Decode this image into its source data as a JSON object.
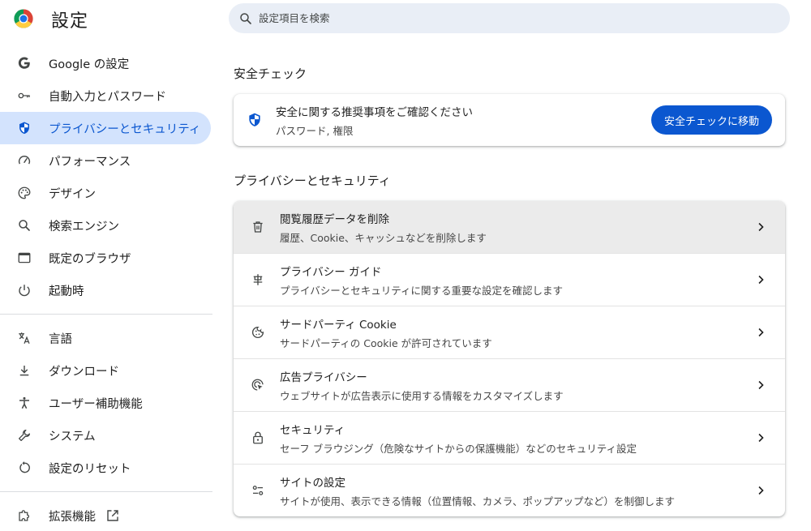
{
  "app": {
    "title": "設定"
  },
  "search": {
    "placeholder": "設定項目を検索"
  },
  "sidebar": {
    "items": [
      {
        "label": "Google の設定",
        "icon": "google-icon"
      },
      {
        "label": "自動入力とパスワード",
        "icon": "key-icon"
      },
      {
        "label": "プライバシーとセキュリティ",
        "icon": "shield-icon",
        "active": true
      },
      {
        "label": "パフォーマンス",
        "icon": "speedometer-icon"
      },
      {
        "label": "デザイン",
        "icon": "palette-icon"
      },
      {
        "label": "検索エンジン",
        "icon": "search-icon"
      },
      {
        "label": "既定のブラウザ",
        "icon": "browser-window-icon"
      },
      {
        "label": "起動時",
        "icon": "power-icon"
      },
      {
        "label": "言語",
        "icon": "translate-icon"
      },
      {
        "label": "ダウンロード",
        "icon": "download-icon"
      },
      {
        "label": "ユーザー補助機能",
        "icon": "accessibility-icon"
      },
      {
        "label": "システム",
        "icon": "wrench-icon"
      },
      {
        "label": "設定のリセット",
        "icon": "reset-icon"
      },
      {
        "label": "拡張機能",
        "icon": "puzzle-icon"
      }
    ]
  },
  "safety_check": {
    "title": "安全チェック",
    "primary": "安全に関する推奨事項をご確認ください",
    "secondary": "パスワード, 権限",
    "button": "安全チェックに移動"
  },
  "privacy": {
    "title": "プライバシーとセキュリティ",
    "rows": [
      {
        "primary": "閲覧履歴データを削除",
        "secondary": "履歴、Cookie、キャッシュなどを削除します",
        "icon": "trash-icon"
      },
      {
        "primary": "プライバシー ガイド",
        "secondary": "プライバシーとセキュリティに関する重要な設定を確認します",
        "icon": "privacy-guide-icon"
      },
      {
        "primary": "サードパーティ Cookie",
        "secondary": "サードパーティの Cookie が許可されています",
        "icon": "cookie-icon"
      },
      {
        "primary": "広告プライバシー",
        "secondary": "ウェブサイトが広告表示に使用する情報をカスタマイズします",
        "icon": "ad-privacy-icon"
      },
      {
        "primary": "セキュリティ",
        "secondary": "セーフ ブラウジング（危険なサイトからの保護機能）などのセキュリティ設定",
        "icon": "lock-icon"
      },
      {
        "primary": "サイトの設定",
        "secondary": "サイトが使用、表示できる情報（位置情報、カメラ、ポップアップなど）を制御します",
        "icon": "site-settings-icon"
      }
    ]
  },
  "colors": {
    "accent": "#0b57d0",
    "active_bg": "#d3e3fd",
    "search_bg": "#e9eef6",
    "hover_row": "#ebebeb"
  }
}
